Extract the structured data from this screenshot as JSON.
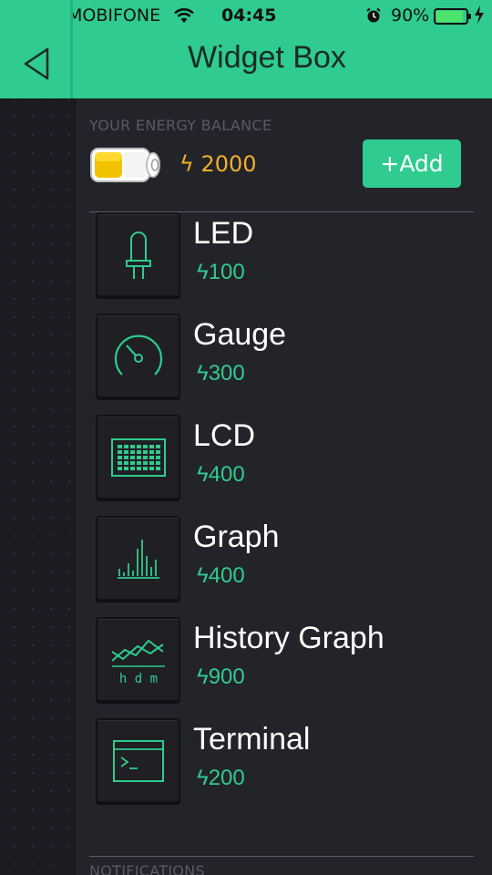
{
  "status_bar": {
    "carrier": "MOBIFONE",
    "time": "04:45",
    "battery_percent": "90%",
    "battery_level": 0.9,
    "signal_bars": 4,
    "signal_max": 5
  },
  "header": {
    "title": "Widget Box",
    "back_icon": "back-triangle-icon"
  },
  "energy": {
    "label": "YOUR ENERGY BALANCE",
    "bolt": "ϟ",
    "value": "2000",
    "add_label": "+Add"
  },
  "widgets": [
    {
      "name": "LED",
      "bolt": "ϟ",
      "cost": "100",
      "icon": "led-icon"
    },
    {
      "name": "Gauge",
      "bolt": "ϟ",
      "cost": "300",
      "icon": "gauge-icon"
    },
    {
      "name": "LCD",
      "bolt": "ϟ",
      "cost": "400",
      "icon": "lcd-icon"
    },
    {
      "name": "Graph",
      "bolt": "ϟ",
      "cost": "400",
      "icon": "graph-icon"
    },
    {
      "name": "History Graph",
      "bolt": "ϟ",
      "cost": "900",
      "icon": "history-graph-icon",
      "icon_caption": "h d m"
    },
    {
      "name": "Terminal",
      "bolt": "ϟ",
      "cost": "200",
      "icon": "terminal-icon"
    }
  ],
  "notifications": {
    "label": "NOTIFICATIONS"
  },
  "colors": {
    "accent": "#2fcb8f",
    "energy": "#f0b02a",
    "background": "#23232a"
  }
}
